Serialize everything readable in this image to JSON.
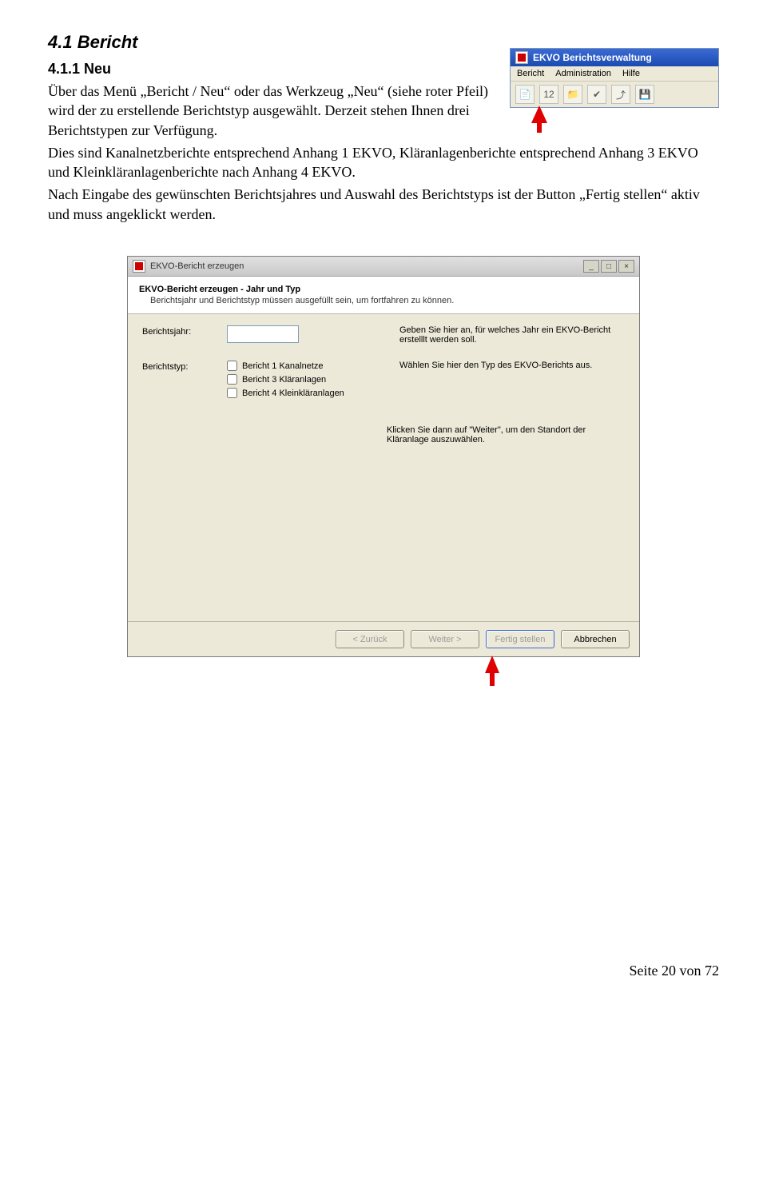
{
  "headings": {
    "h2": "4.1  Bericht",
    "h3": "4.1.1  Neu"
  },
  "paragraph": {
    "p1": "Über das Menü „Bericht / Neu“ oder das Werkzeug „Neu“ (siehe roter Pfeil) wird der zu erstellende Berichtstyp ausgewählt. Derzeit stehen Ihnen drei Berichtstypen zur Verfügung.",
    "p2": "Dies sind Kanalnetzberichte entsprechend Anhang 1 EKVO, Kläranlagenberichte entsprechend Anhang 3 EKVO und Kleinkläranlagenberichte nach Anhang 4 EKVO.",
    "p3": "Nach Eingabe des gewünschten Berichtsjahres und Auswahl des Berichtstyps  ist der Button „Fertig stellen“ aktiv und muss angeklickt werden."
  },
  "app_thumb": {
    "title": "EKVO Berichtsverwaltung",
    "menu": {
      "m1": "Bericht",
      "m2": "Administration",
      "m3": "Hilfe"
    },
    "toolbar_badge": "12"
  },
  "wizard": {
    "window_title": "EKVO-Bericht erzeugen",
    "header_title": "EKVO-Bericht erzeugen - Jahr und Typ",
    "header_sub": "Berichtsjahr und Berichtstyp müssen ausgefüllt sein, um fortfahren zu können.",
    "rows": {
      "year_label": "Berichtsjahr:",
      "year_hint": "Geben Sie hier an, für welches Jahr ein EKVO-Bericht erstelllt werden soll.",
      "type_label": "Berichtstyp:",
      "type_hint": "Wählen Sie hier den Typ des EKVO-Berichts aus.",
      "cb1": "Bericht 1 Kanalnetze",
      "cb2": "Bericht 3 Kläranlagen",
      "cb3": "Bericht 4 Kleinkläranlagen",
      "note": "Klicken Sie dann auf \"Weiter\", um den Standort der Kläranlage auszuwählen."
    },
    "buttons": {
      "back": "< Zurück",
      "next": "Weiter >",
      "finish": "Fertig stellen",
      "cancel": "Abbrechen"
    },
    "winbtn_min": "_",
    "winbtn_max": "□",
    "winbtn_close": "×"
  },
  "footer": "Seite 20 von 72"
}
